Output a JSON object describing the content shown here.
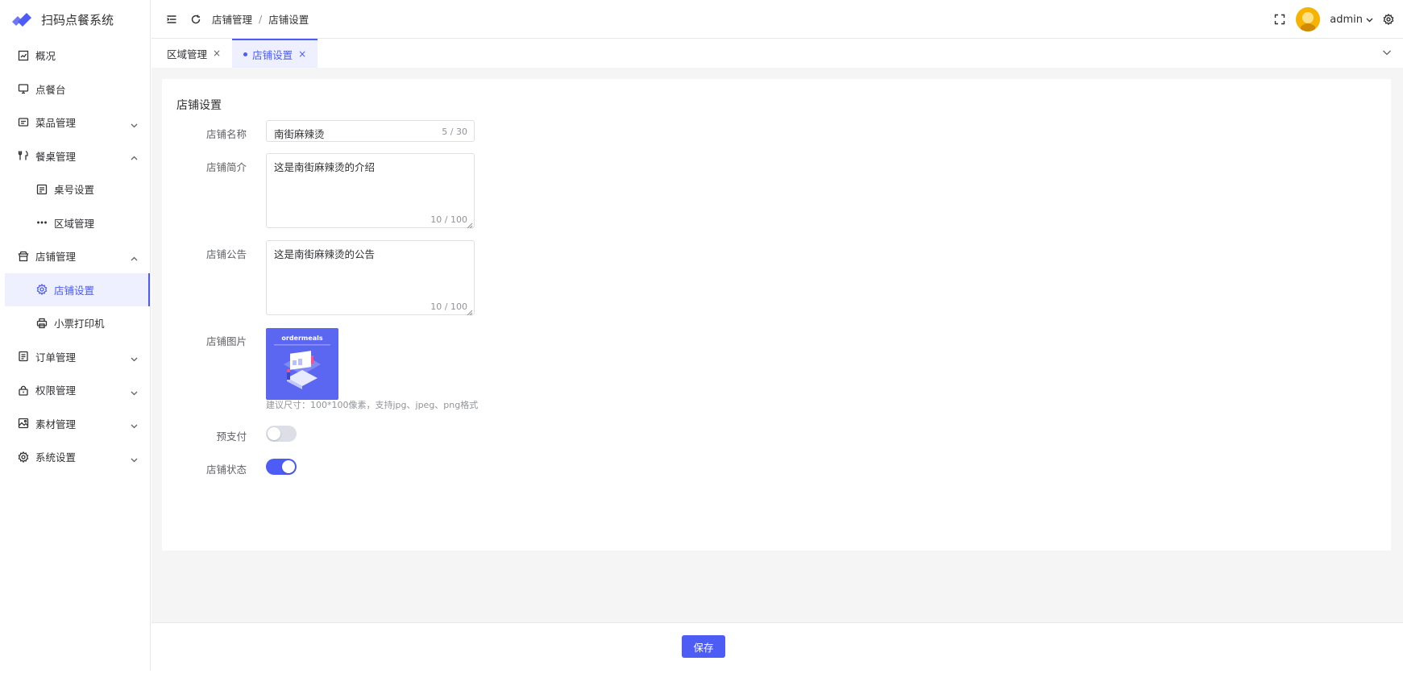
{
  "app": {
    "title": "扫码点餐系统",
    "brand_color": "#4d5cf5"
  },
  "sidebar": {
    "items": [
      {
        "label": "概况",
        "icon": "dashboard-icon"
      },
      {
        "label": "点餐台",
        "icon": "monitor-icon"
      },
      {
        "label": "菜品管理",
        "icon": "message-icon",
        "expanded": false
      },
      {
        "label": "餐桌管理",
        "icon": "fork-knife-icon",
        "expanded": true
      },
      {
        "label": "桌号设置",
        "icon": "table-icon"
      },
      {
        "label": "区域管理",
        "icon": "more-icon"
      },
      {
        "label": "店铺管理",
        "icon": "shop-icon",
        "expanded": true
      },
      {
        "label": "店铺设置",
        "icon": "gear-icon",
        "active": true
      },
      {
        "label": "小票打印机",
        "icon": "printer-icon"
      },
      {
        "label": "订单管理",
        "icon": "document-icon",
        "expanded": false
      },
      {
        "label": "权限管理",
        "icon": "lock-icon",
        "expanded": false
      },
      {
        "label": "素材管理",
        "icon": "picture-icon",
        "expanded": false
      },
      {
        "label": "系统设置",
        "icon": "gear-icon",
        "expanded": false
      }
    ]
  },
  "header": {
    "breadcrumb": [
      "店铺管理",
      "店铺设置"
    ],
    "breadcrumb_sep": "/",
    "username": "admin"
  },
  "tabs": [
    {
      "label": "区域管理",
      "active": false,
      "close": "×"
    },
    {
      "label": "店铺设置",
      "active": true,
      "close": "×"
    }
  ],
  "form": {
    "title": "店铺设置",
    "name": {
      "label": "店铺名称",
      "value": "南街麻辣烫",
      "count": "5 / 30"
    },
    "intro": {
      "label": "店铺简介",
      "value": "这是南街麻辣烫的介绍",
      "count": "10 / 100"
    },
    "notice": {
      "label": "店铺公告",
      "value": "这是南街麻辣烫的公告",
      "count": "10 / 100"
    },
    "image": {
      "label": "店铺图片",
      "brand_text": "ordermeals",
      "hint": "建议尺寸：100*100像素，支持jpg、jpeg、png格式"
    },
    "prepay": {
      "label": "预支付",
      "enabled": false
    },
    "status": {
      "label": "店铺状态",
      "enabled": true
    }
  },
  "footer": {
    "save_label": "保存"
  }
}
